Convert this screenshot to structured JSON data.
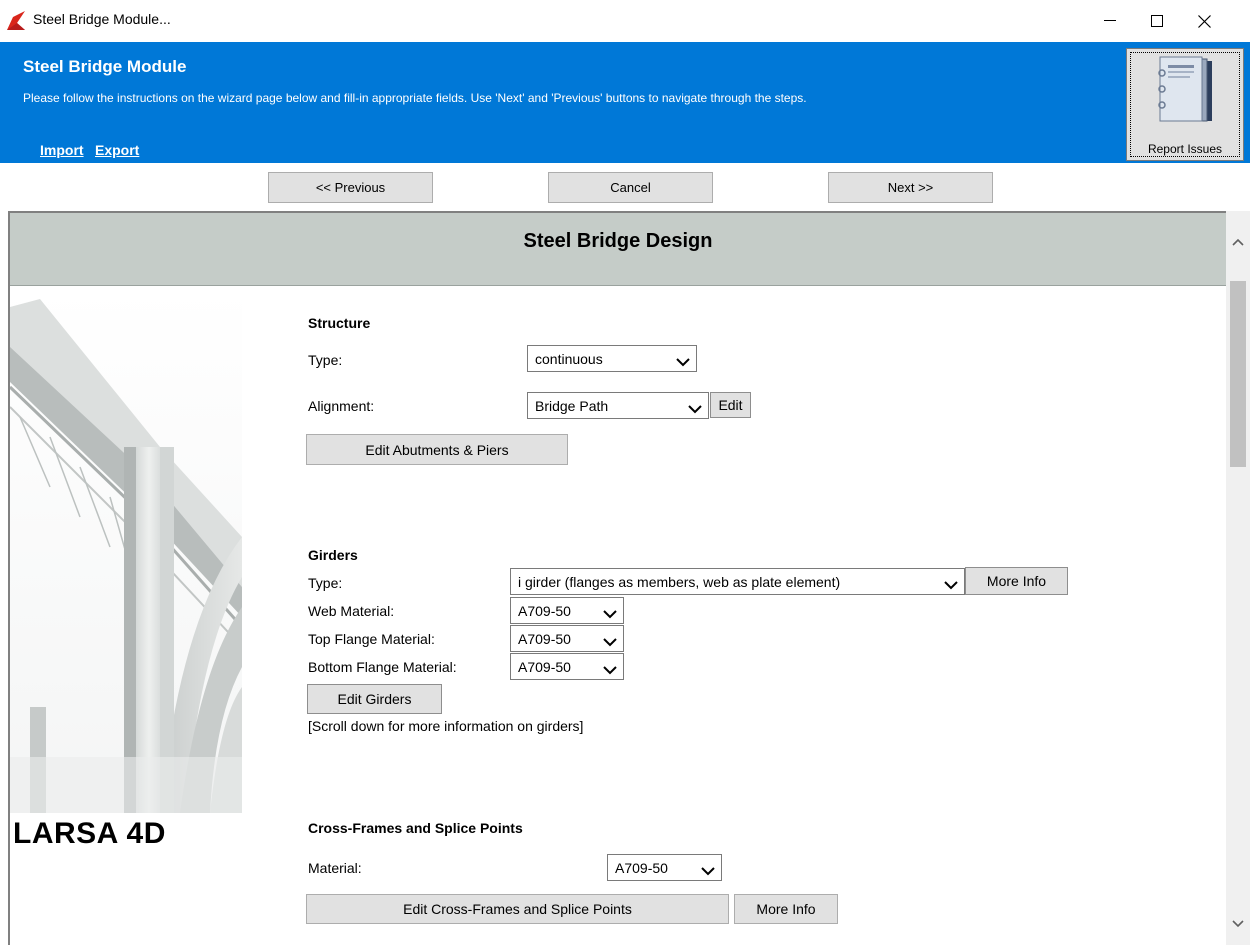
{
  "window": {
    "title": "Steel Bridge Module...",
    "minimize_icon": "minimize-icon",
    "maximize_icon": "maximize-icon",
    "close_icon": "close-icon"
  },
  "header": {
    "title": "Steel Bridge Module",
    "description": "Please follow the instructions on the wizard page below and fill-in appropriate fields. Use 'Next' and 'Previous' buttons to navigate through the steps.",
    "links": {
      "import": "Import",
      "export": "Export"
    },
    "report_button": "Report Issues",
    "background": "#0078d7"
  },
  "nav": {
    "previous": "<< Previous",
    "cancel": "Cancel",
    "next": "Next >>"
  },
  "page": {
    "title": "Steel Bridge Design",
    "brand": "LARSA 4D",
    "structure": {
      "heading": "Structure",
      "type_label": "Type:",
      "type_value": "continuous",
      "alignment_label": "Alignment:",
      "alignment_value": "Bridge Path",
      "edit_button": "Edit",
      "abutments_button": "Edit Abutments & Piers"
    },
    "girders": {
      "heading": "Girders",
      "type_label": "Type:",
      "type_value": "i girder (flanges as members, web as plate element)",
      "more_info_button": "More Info",
      "web_material_label": "Web Material:",
      "web_material_value": "A709-50",
      "top_flange_label": "Top Flange Material:",
      "top_flange_value": "A709-50",
      "bottom_flange_label": "Bottom Flange Material:",
      "bottom_flange_value": "A709-50",
      "edit_button": "Edit Girders",
      "note": "[Scroll down for more information on girders]"
    },
    "cross_frames": {
      "heading": "Cross-Frames and Splice Points",
      "material_label": "Material:",
      "material_value": "A709-50",
      "edit_button": "Edit Cross-Frames and Splice Points",
      "more_info_button": "More Info"
    }
  }
}
